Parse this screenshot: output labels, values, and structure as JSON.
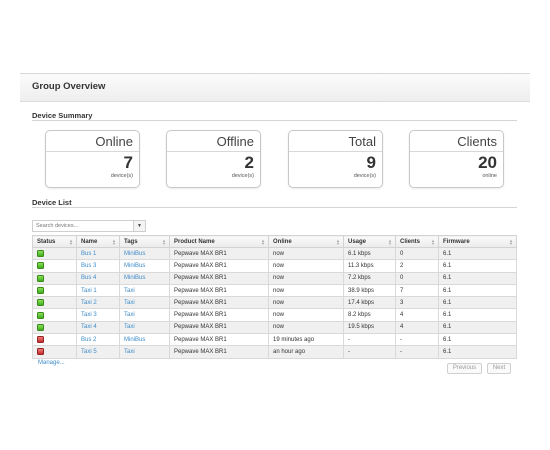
{
  "page": {
    "title": "Group Overview"
  },
  "summary": {
    "title": "Device Summary",
    "cards": [
      {
        "title": "Online",
        "value": "7",
        "unit": "device(s)"
      },
      {
        "title": "Offline",
        "value": "2",
        "unit": "device(s)"
      },
      {
        "title": "Total",
        "value": "9",
        "unit": "device(s)"
      },
      {
        "title": "Clients",
        "value": "20",
        "unit": "online"
      }
    ]
  },
  "device_list": {
    "title": "Device List",
    "search_placeholder": "Search devices...",
    "dropdown_icon": "chevron-down-icon",
    "columns": [
      "Status",
      "Name",
      "Tags",
      "Product Name",
      "Online",
      "Usage",
      "Clients",
      "Firmware"
    ],
    "rows": [
      {
        "status": "online",
        "name": "Bus 1",
        "tags": "MiniBus",
        "product": "Pepwave MAX BR1",
        "online": "now",
        "usage": "6.1 kbps",
        "clients": "0",
        "firmware": "6.1"
      },
      {
        "status": "online",
        "name": "Bus 3",
        "tags": "MiniBus",
        "product": "Pepwave MAX BR1",
        "online": "now",
        "usage": "11.3 kbps",
        "clients": "2",
        "firmware": "6.1"
      },
      {
        "status": "online",
        "name": "Bus 4",
        "tags": "MiniBus",
        "product": "Pepwave MAX BR1",
        "online": "now",
        "usage": "7.2 kbps",
        "clients": "0",
        "firmware": "6.1"
      },
      {
        "status": "online",
        "name": "Taxi 1",
        "tags": "Taxi",
        "product": "Pepwave MAX BR1",
        "online": "now",
        "usage": "38.9 kbps",
        "clients": "7",
        "firmware": "6.1"
      },
      {
        "status": "online",
        "name": "Taxi 2",
        "tags": "Taxi",
        "product": "Pepwave MAX BR1",
        "online": "now",
        "usage": "17.4 kbps",
        "clients": "3",
        "firmware": "6.1"
      },
      {
        "status": "online",
        "name": "Taxi 3",
        "tags": "Taxi",
        "product": "Pepwave MAX BR1",
        "online": "now",
        "usage": "8.2 kbps",
        "clients": "4",
        "firmware": "6.1"
      },
      {
        "status": "online",
        "name": "Taxi 4",
        "tags": "Taxi",
        "product": "Pepwave MAX BR1",
        "online": "now",
        "usage": "19.5 kbps",
        "clients": "4",
        "firmware": "6.1"
      },
      {
        "status": "offline",
        "name": "Bus 2",
        "tags": "MiniBus",
        "product": "Pepwave MAX BR1",
        "online": "19 minutes ago",
        "usage": "-",
        "clients": "-",
        "firmware": "6.1"
      },
      {
        "status": "offline",
        "name": "Taxi 5",
        "tags": "Taxi",
        "product": "Pepwave MAX BR1",
        "online": "an hour ago",
        "usage": "-",
        "clients": "-",
        "firmware": "6.1"
      }
    ],
    "manage_link": "Manage...",
    "pagination": {
      "previous": "Previous",
      "next": "Next"
    }
  },
  "colors": {
    "link": "#3d8bc9",
    "status_online": "#3fae1e",
    "status_offline": "#c52d2d"
  }
}
